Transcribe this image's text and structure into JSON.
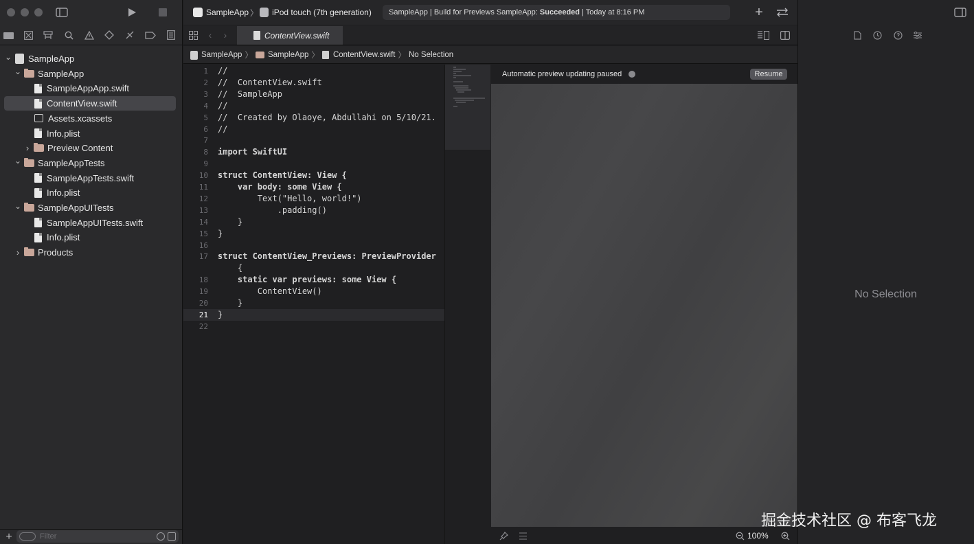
{
  "toolbar": {
    "scheme": {
      "project": "SampleApp",
      "separator": "〉",
      "device": "iPod touch (7th generation)"
    },
    "activity": {
      "prefix": "SampleApp | Build for Previews SampleApp: ",
      "status": "Succeeded",
      "suffix": " | Today at 8:16 PM"
    }
  },
  "editor": {
    "tab_label": "ContentView.swift",
    "jumpbar": [
      "SampleApp",
      "SampleApp",
      "ContentView.swift",
      "No Selection"
    ],
    "code_lines": [
      {
        "n": "1",
        "t": "//"
      },
      {
        "n": "2",
        "t": "//  ContentView.swift"
      },
      {
        "n": "3",
        "t": "//  SampleApp"
      },
      {
        "n": "4",
        "t": "//"
      },
      {
        "n": "5",
        "t": "//  Created by Olaoye, Abdullahi on 5/10/21."
      },
      {
        "n": "6",
        "t": "//"
      },
      {
        "n": "7",
        "t": ""
      },
      {
        "n": "8",
        "t": "import SwiftUI"
      },
      {
        "n": "9",
        "t": ""
      },
      {
        "n": "10",
        "t": "struct ContentView: View {"
      },
      {
        "n": "11",
        "t": "    var body: some View {"
      },
      {
        "n": "12",
        "t": "        Text(\"Hello, world!\")"
      },
      {
        "n": "13",
        "t": "            .padding()"
      },
      {
        "n": "14",
        "t": "    }"
      },
      {
        "n": "15",
        "t": "}"
      },
      {
        "n": "16",
        "t": ""
      },
      {
        "n": "17",
        "t": "struct ContentView_Previews: PreviewProvider"
      },
      {
        "n": "",
        "t": "    {"
      },
      {
        "n": "18",
        "t": "    static var previews: some View {"
      },
      {
        "n": "19",
        "t": "        ContentView()"
      },
      {
        "n": "20",
        "t": "    }"
      },
      {
        "n": "21",
        "t": "}"
      },
      {
        "n": "22",
        "t": ""
      }
    ],
    "current_line": "21"
  },
  "canvas": {
    "message": "Automatic preview updating paused",
    "resume_label": "Resume",
    "zoom": "100%"
  },
  "navigator": {
    "filter_placeholder": "Filter",
    "items": [
      {
        "label": "SampleApp",
        "kind": "project",
        "depth": 0,
        "disclosure": "open"
      },
      {
        "label": "SampleApp",
        "kind": "folder",
        "depth": 1,
        "disclosure": "open"
      },
      {
        "label": "SampleAppApp.swift",
        "kind": "file",
        "depth": 2,
        "disclosure": ""
      },
      {
        "label": "ContentView.swift",
        "kind": "file",
        "depth": 2,
        "disclosure": "",
        "selected": true
      },
      {
        "label": "Assets.xcassets",
        "kind": "assets",
        "depth": 2,
        "disclosure": ""
      },
      {
        "label": "Info.plist",
        "kind": "file",
        "depth": 2,
        "disclosure": ""
      },
      {
        "label": "Preview Content",
        "kind": "folder",
        "depth": 2,
        "disclosure": "closed"
      },
      {
        "label": "SampleAppTests",
        "kind": "folder",
        "depth": 1,
        "disclosure": "open"
      },
      {
        "label": "SampleAppTests.swift",
        "kind": "file",
        "depth": 2,
        "disclosure": ""
      },
      {
        "label": "Info.plist",
        "kind": "file",
        "depth": 2,
        "disclosure": ""
      },
      {
        "label": "SampleAppUITests",
        "kind": "folder",
        "depth": 1,
        "disclosure": "open"
      },
      {
        "label": "SampleAppUITests.swift",
        "kind": "file",
        "depth": 2,
        "disclosure": ""
      },
      {
        "label": "Info.plist",
        "kind": "file",
        "depth": 2,
        "disclosure": ""
      },
      {
        "label": "Products",
        "kind": "folder",
        "depth": 1,
        "disclosure": "closed"
      }
    ]
  },
  "inspector": {
    "empty_label": "No Selection"
  },
  "watermark": "掘金技术社区 @ 布客飞龙"
}
